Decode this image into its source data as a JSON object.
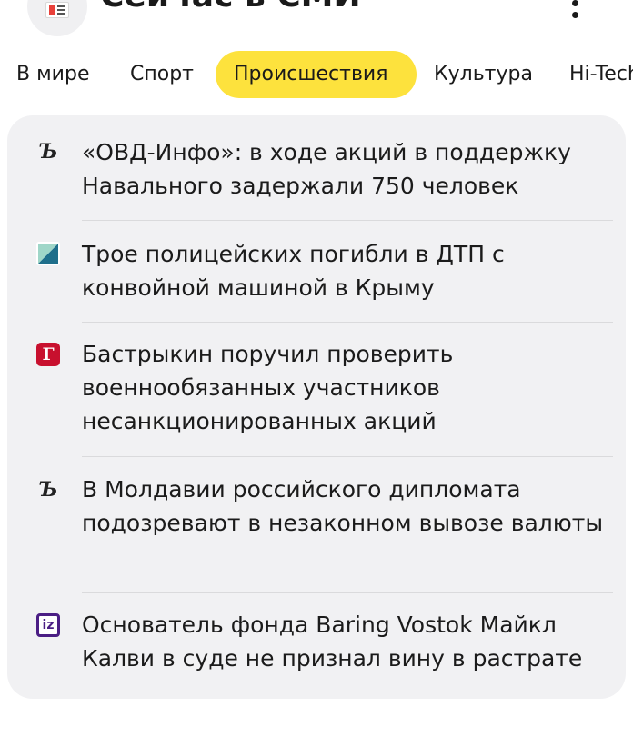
{
  "header": {
    "title": "Сейчас в СМИ",
    "app_icon": "news-app-icon",
    "menu_icon": "more-vertical-icon"
  },
  "tabs": [
    {
      "label": "В мире",
      "active": false
    },
    {
      "label": "Спорт",
      "active": false
    },
    {
      "label": "Происшествия",
      "active": true
    },
    {
      "label": "Культура",
      "active": false
    },
    {
      "label": "Hi-Tech",
      "active": false
    }
  ],
  "colors": {
    "active_tab": "#fde23d",
    "card_background": "#f1f1f3",
    "gazeta_red": "#c8102e",
    "izvestia_purple": "#4b1e84"
  },
  "news": [
    {
      "source_icon": "kommersant-icon",
      "glyph": "Ъ",
      "text": "«ОВД-Инфо»: в ходе акций в поддержку Навального задержали 750 человек"
    },
    {
      "source_icon": "source-square-icon",
      "glyph": "",
      "text": "Трое полицейских погибли в ДТП с конвойной машиной в Крыму"
    },
    {
      "source_icon": "gazeta-icon",
      "glyph": "Г",
      "text": "Бастрыкин поручил проверить военнообязанных участников несанкционированных акций"
    },
    {
      "source_icon": "kommersant-icon",
      "glyph": "Ъ",
      "text": "В Молдавии российского дипломата подозревают в незаконном вывозе валюты"
    },
    {
      "source_icon": "izvestia-icon",
      "glyph": "iz",
      "text": "Основатель фонда Baring Vostok Майкл Калви в суде не признал вину в растрате"
    }
  ]
}
